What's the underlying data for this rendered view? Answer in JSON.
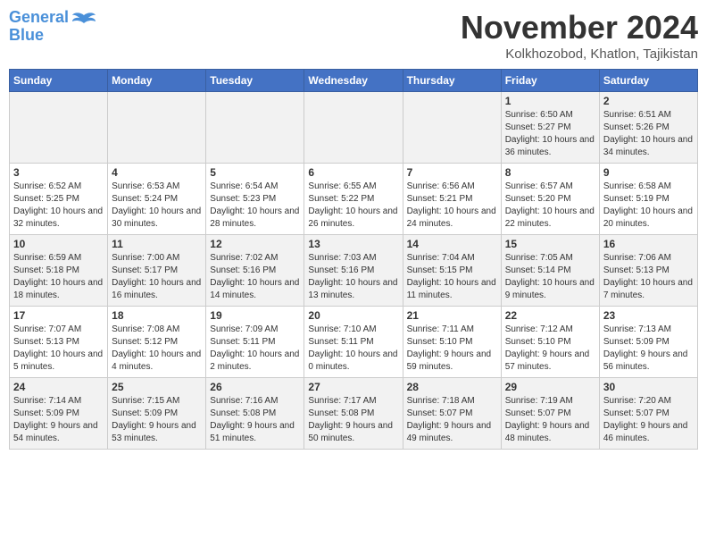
{
  "logo": {
    "text_general": "General",
    "text_blue": "Blue"
  },
  "header": {
    "month_title": "November 2024",
    "location": "Kolkhozobod, Khatlon, Tajikistan"
  },
  "weekdays": [
    "Sunday",
    "Monday",
    "Tuesday",
    "Wednesday",
    "Thursday",
    "Friday",
    "Saturday"
  ],
  "weeks": [
    [
      {
        "day": "",
        "sunrise": "",
        "sunset": "",
        "daylight": ""
      },
      {
        "day": "",
        "sunrise": "",
        "sunset": "",
        "daylight": ""
      },
      {
        "day": "",
        "sunrise": "",
        "sunset": "",
        "daylight": ""
      },
      {
        "day": "",
        "sunrise": "",
        "sunset": "",
        "daylight": ""
      },
      {
        "day": "",
        "sunrise": "",
        "sunset": "",
        "daylight": ""
      },
      {
        "day": "1",
        "sunrise": "Sunrise: 6:50 AM",
        "sunset": "Sunset: 5:27 PM",
        "daylight": "Daylight: 10 hours and 36 minutes."
      },
      {
        "day": "2",
        "sunrise": "Sunrise: 6:51 AM",
        "sunset": "Sunset: 5:26 PM",
        "daylight": "Daylight: 10 hours and 34 minutes."
      }
    ],
    [
      {
        "day": "3",
        "sunrise": "Sunrise: 6:52 AM",
        "sunset": "Sunset: 5:25 PM",
        "daylight": "Daylight: 10 hours and 32 minutes."
      },
      {
        "day": "4",
        "sunrise": "Sunrise: 6:53 AM",
        "sunset": "Sunset: 5:24 PM",
        "daylight": "Daylight: 10 hours and 30 minutes."
      },
      {
        "day": "5",
        "sunrise": "Sunrise: 6:54 AM",
        "sunset": "Sunset: 5:23 PM",
        "daylight": "Daylight: 10 hours and 28 minutes."
      },
      {
        "day": "6",
        "sunrise": "Sunrise: 6:55 AM",
        "sunset": "Sunset: 5:22 PM",
        "daylight": "Daylight: 10 hours and 26 minutes."
      },
      {
        "day": "7",
        "sunrise": "Sunrise: 6:56 AM",
        "sunset": "Sunset: 5:21 PM",
        "daylight": "Daylight: 10 hours and 24 minutes."
      },
      {
        "day": "8",
        "sunrise": "Sunrise: 6:57 AM",
        "sunset": "Sunset: 5:20 PM",
        "daylight": "Daylight: 10 hours and 22 minutes."
      },
      {
        "day": "9",
        "sunrise": "Sunrise: 6:58 AM",
        "sunset": "Sunset: 5:19 PM",
        "daylight": "Daylight: 10 hours and 20 minutes."
      }
    ],
    [
      {
        "day": "10",
        "sunrise": "Sunrise: 6:59 AM",
        "sunset": "Sunset: 5:18 PM",
        "daylight": "Daylight: 10 hours and 18 minutes."
      },
      {
        "day": "11",
        "sunrise": "Sunrise: 7:00 AM",
        "sunset": "Sunset: 5:17 PM",
        "daylight": "Daylight: 10 hours and 16 minutes."
      },
      {
        "day": "12",
        "sunrise": "Sunrise: 7:02 AM",
        "sunset": "Sunset: 5:16 PM",
        "daylight": "Daylight: 10 hours and 14 minutes."
      },
      {
        "day": "13",
        "sunrise": "Sunrise: 7:03 AM",
        "sunset": "Sunset: 5:16 PM",
        "daylight": "Daylight: 10 hours and 13 minutes."
      },
      {
        "day": "14",
        "sunrise": "Sunrise: 7:04 AM",
        "sunset": "Sunset: 5:15 PM",
        "daylight": "Daylight: 10 hours and 11 minutes."
      },
      {
        "day": "15",
        "sunrise": "Sunrise: 7:05 AM",
        "sunset": "Sunset: 5:14 PM",
        "daylight": "Daylight: 10 hours and 9 minutes."
      },
      {
        "day": "16",
        "sunrise": "Sunrise: 7:06 AM",
        "sunset": "Sunset: 5:13 PM",
        "daylight": "Daylight: 10 hours and 7 minutes."
      }
    ],
    [
      {
        "day": "17",
        "sunrise": "Sunrise: 7:07 AM",
        "sunset": "Sunset: 5:13 PM",
        "daylight": "Daylight: 10 hours and 5 minutes."
      },
      {
        "day": "18",
        "sunrise": "Sunrise: 7:08 AM",
        "sunset": "Sunset: 5:12 PM",
        "daylight": "Daylight: 10 hours and 4 minutes."
      },
      {
        "day": "19",
        "sunrise": "Sunrise: 7:09 AM",
        "sunset": "Sunset: 5:11 PM",
        "daylight": "Daylight: 10 hours and 2 minutes."
      },
      {
        "day": "20",
        "sunrise": "Sunrise: 7:10 AM",
        "sunset": "Sunset: 5:11 PM",
        "daylight": "Daylight: 10 hours and 0 minutes."
      },
      {
        "day": "21",
        "sunrise": "Sunrise: 7:11 AM",
        "sunset": "Sunset: 5:10 PM",
        "daylight": "Daylight: 9 hours and 59 minutes."
      },
      {
        "day": "22",
        "sunrise": "Sunrise: 7:12 AM",
        "sunset": "Sunset: 5:10 PM",
        "daylight": "Daylight: 9 hours and 57 minutes."
      },
      {
        "day": "23",
        "sunrise": "Sunrise: 7:13 AM",
        "sunset": "Sunset: 5:09 PM",
        "daylight": "Daylight: 9 hours and 56 minutes."
      }
    ],
    [
      {
        "day": "24",
        "sunrise": "Sunrise: 7:14 AM",
        "sunset": "Sunset: 5:09 PM",
        "daylight": "Daylight: 9 hours and 54 minutes."
      },
      {
        "day": "25",
        "sunrise": "Sunrise: 7:15 AM",
        "sunset": "Sunset: 5:09 PM",
        "daylight": "Daylight: 9 hours and 53 minutes."
      },
      {
        "day": "26",
        "sunrise": "Sunrise: 7:16 AM",
        "sunset": "Sunset: 5:08 PM",
        "daylight": "Daylight: 9 hours and 51 minutes."
      },
      {
        "day": "27",
        "sunrise": "Sunrise: 7:17 AM",
        "sunset": "Sunset: 5:08 PM",
        "daylight": "Daylight: 9 hours and 50 minutes."
      },
      {
        "day": "28",
        "sunrise": "Sunrise: 7:18 AM",
        "sunset": "Sunset: 5:07 PM",
        "daylight": "Daylight: 9 hours and 49 minutes."
      },
      {
        "day": "29",
        "sunrise": "Sunrise: 7:19 AM",
        "sunset": "Sunset: 5:07 PM",
        "daylight": "Daylight: 9 hours and 48 minutes."
      },
      {
        "day": "30",
        "sunrise": "Sunrise: 7:20 AM",
        "sunset": "Sunset: 5:07 PM",
        "daylight": "Daylight: 9 hours and 46 minutes."
      }
    ]
  ]
}
